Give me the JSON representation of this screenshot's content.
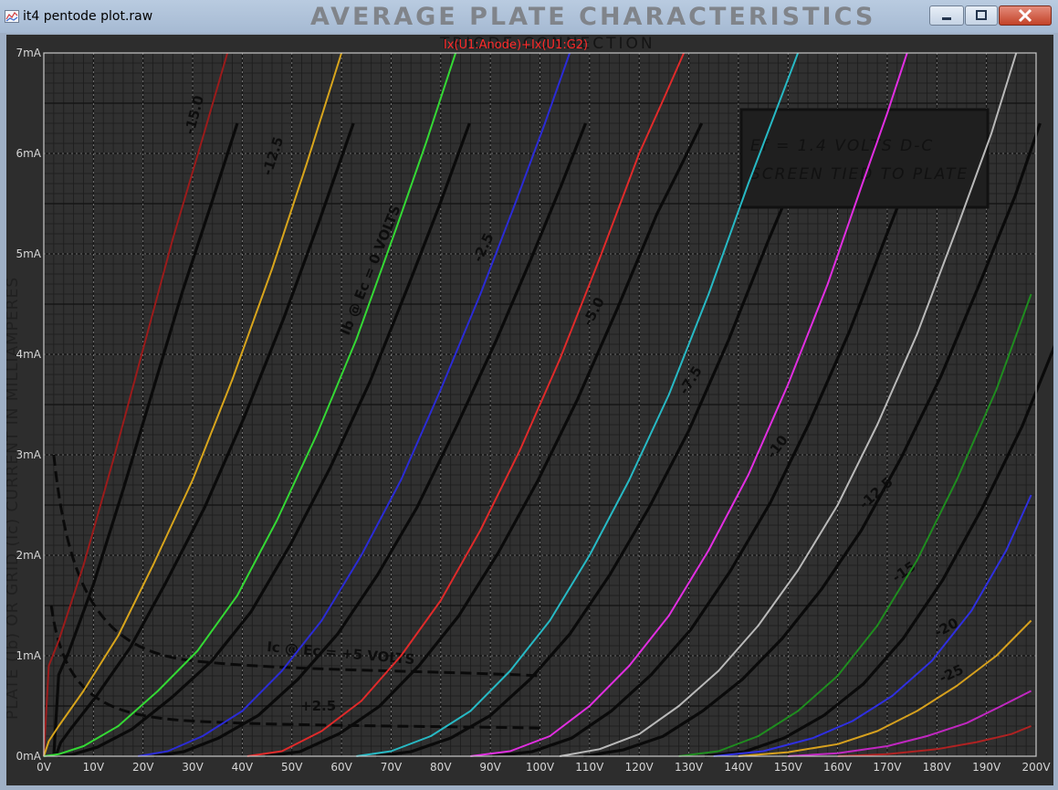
{
  "window": {
    "title": "it4 pentode plot.raw",
    "icon": "plot-file-icon",
    "controls": {
      "minimize": "minimize-icon",
      "maximize": "maximize-icon",
      "close": "close-icon"
    }
  },
  "scan": {
    "header": "AVERAGE PLATE CHARACTERISTICS",
    "subheader": "TRIODE CONNECTION",
    "box_line1": "Ef = 1.4 VOLTS D-C",
    "box_line2": "SCREEN TIED TO PLATE",
    "ylabel": "PLATE (Ib) OR GRID (Ic) CURRENT IN MILLIAMPERES",
    "curve_labels": [
      "-15.0",
      "-12.5",
      "Ib @ Ec = 0 VOLTS",
      "-2.5",
      "-5.0",
      "-7.5",
      "-10",
      "-12.5",
      "-15",
      "-20",
      "-25",
      "Ic @ Ec = +5 VOLTS",
      "+2.5"
    ]
  },
  "chart_data": {
    "type": "line",
    "title": "Ix(U1:Anode)+Ix(U1:G2)",
    "xlabel": "",
    "ylabel": "",
    "x_ticks": [
      "0V",
      "10V",
      "20V",
      "30V",
      "40V",
      "50V",
      "60V",
      "70V",
      "80V",
      "90V",
      "100V",
      "110V",
      "120V",
      "130V",
      "140V",
      "150V",
      "160V",
      "170V",
      "180V",
      "190V",
      "200V"
    ],
    "y_ticks": [
      "0mA",
      "1mA",
      "2mA",
      "3mA",
      "4mA",
      "5mA",
      "6mA",
      "7mA"
    ],
    "xlim": [
      0,
      200
    ],
    "ylim": [
      0,
      7
    ],
    "grid": true,
    "colors": {
      "background": "#2d2d2d",
      "tick_text": "#d6d6d6",
      "title": "#ff2a2a"
    },
    "series": [
      {
        "color": "#9b1b1b",
        "x": [
          0,
          1,
          3,
          8,
          14,
          20,
          26,
          32,
          37
        ],
        "y": [
          0,
          0.9,
          1.15,
          1.9,
          2.95,
          4.05,
          5.15,
          6.15,
          7
        ]
      },
      {
        "color": "#d8a51c",
        "x": [
          0,
          1,
          3,
          8,
          15,
          22,
          30,
          38,
          46,
          53,
          60
        ],
        "y": [
          0,
          0.15,
          0.3,
          0.65,
          1.2,
          1.9,
          2.75,
          3.75,
          4.85,
          5.9,
          7
        ]
      },
      {
        "color": "#34d934",
        "x": [
          0,
          3,
          8,
          15,
          23,
          31,
          39,
          47,
          55,
          63,
          71,
          77,
          83
        ],
        "y": [
          0,
          0.02,
          0.1,
          0.3,
          0.65,
          1.05,
          1.6,
          2.35,
          3.2,
          4.15,
          5.25,
          6.1,
          7
        ]
      },
      {
        "color": "#2b2bd6",
        "x": [
          19,
          25,
          32,
          40,
          48,
          56,
          64,
          72,
          80,
          88,
          95,
          101,
          106
        ],
        "y": [
          0,
          0.05,
          0.2,
          0.45,
          0.85,
          1.35,
          2.0,
          2.75,
          3.65,
          4.6,
          5.5,
          6.3,
          7
        ]
      },
      {
        "color": "#e02a2a",
        "x": [
          41,
          48,
          56,
          64,
          72,
          80,
          88,
          96,
          104,
          112,
          120,
          125,
          129
        ],
        "y": [
          0,
          0.05,
          0.25,
          0.55,
          1.0,
          1.55,
          2.25,
          3.05,
          3.95,
          4.95,
          6.0,
          6.55,
          7
        ]
      },
      {
        "color": "#27b9c4",
        "x": [
          63,
          70,
          78,
          86,
          94,
          102,
          110,
          118,
          126,
          134,
          142,
          147,
          152
        ],
        "y": [
          0,
          0.05,
          0.2,
          0.45,
          0.85,
          1.35,
          2.0,
          2.75,
          3.6,
          4.6,
          5.7,
          6.35,
          7
        ]
      },
      {
        "color": "#e12ee1",
        "x": [
          86,
          94,
          102,
          110,
          118,
          126,
          134,
          142,
          150,
          158,
          165,
          170,
          174
        ],
        "y": [
          0,
          0.05,
          0.2,
          0.5,
          0.9,
          1.4,
          2.05,
          2.8,
          3.7,
          4.7,
          5.7,
          6.4,
          7
        ]
      },
      {
        "color": "#b9b9b9",
        "x": [
          104,
          112,
          120,
          128,
          136,
          144,
          152,
          160,
          168,
          176,
          184,
          191,
          196
        ],
        "y": [
          0,
          0.07,
          0.22,
          0.5,
          0.85,
          1.3,
          1.85,
          2.5,
          3.3,
          4.2,
          5.25,
          6.2,
          7
        ]
      },
      {
        "color": "#1f8c1f",
        "x": [
          128,
          136,
          144,
          152,
          160,
          168,
          176,
          184,
          192,
          199
        ],
        "y": [
          0,
          0.05,
          0.2,
          0.45,
          0.8,
          1.3,
          1.95,
          2.75,
          3.65,
          4.6
        ]
      },
      {
        "color": "#2f2fe0",
        "x": [
          135,
          145,
          155,
          163,
          171,
          179,
          187,
          194,
          199
        ],
        "y": [
          0,
          0.05,
          0.18,
          0.35,
          0.6,
          0.95,
          1.45,
          2.05,
          2.6
        ]
      },
      {
        "color": "#d6a01e",
        "x": [
          140,
          150,
          160,
          168,
          176,
          184,
          192,
          199
        ],
        "y": [
          0,
          0.04,
          0.12,
          0.25,
          0.45,
          0.7,
          1.0,
          1.35
        ]
      },
      {
        "color": "#c027c0",
        "x": [
          150,
          160,
          170,
          178,
          186,
          193,
          199
        ],
        "y": [
          0,
          0.03,
          0.1,
          0.2,
          0.33,
          0.5,
          0.65
        ]
      },
      {
        "color": "#b02222",
        "x": [
          160,
          170,
          180,
          188,
          195,
          199
        ],
        "y": [
          0,
          0.02,
          0.07,
          0.14,
          0.22,
          0.3
        ]
      }
    ]
  }
}
